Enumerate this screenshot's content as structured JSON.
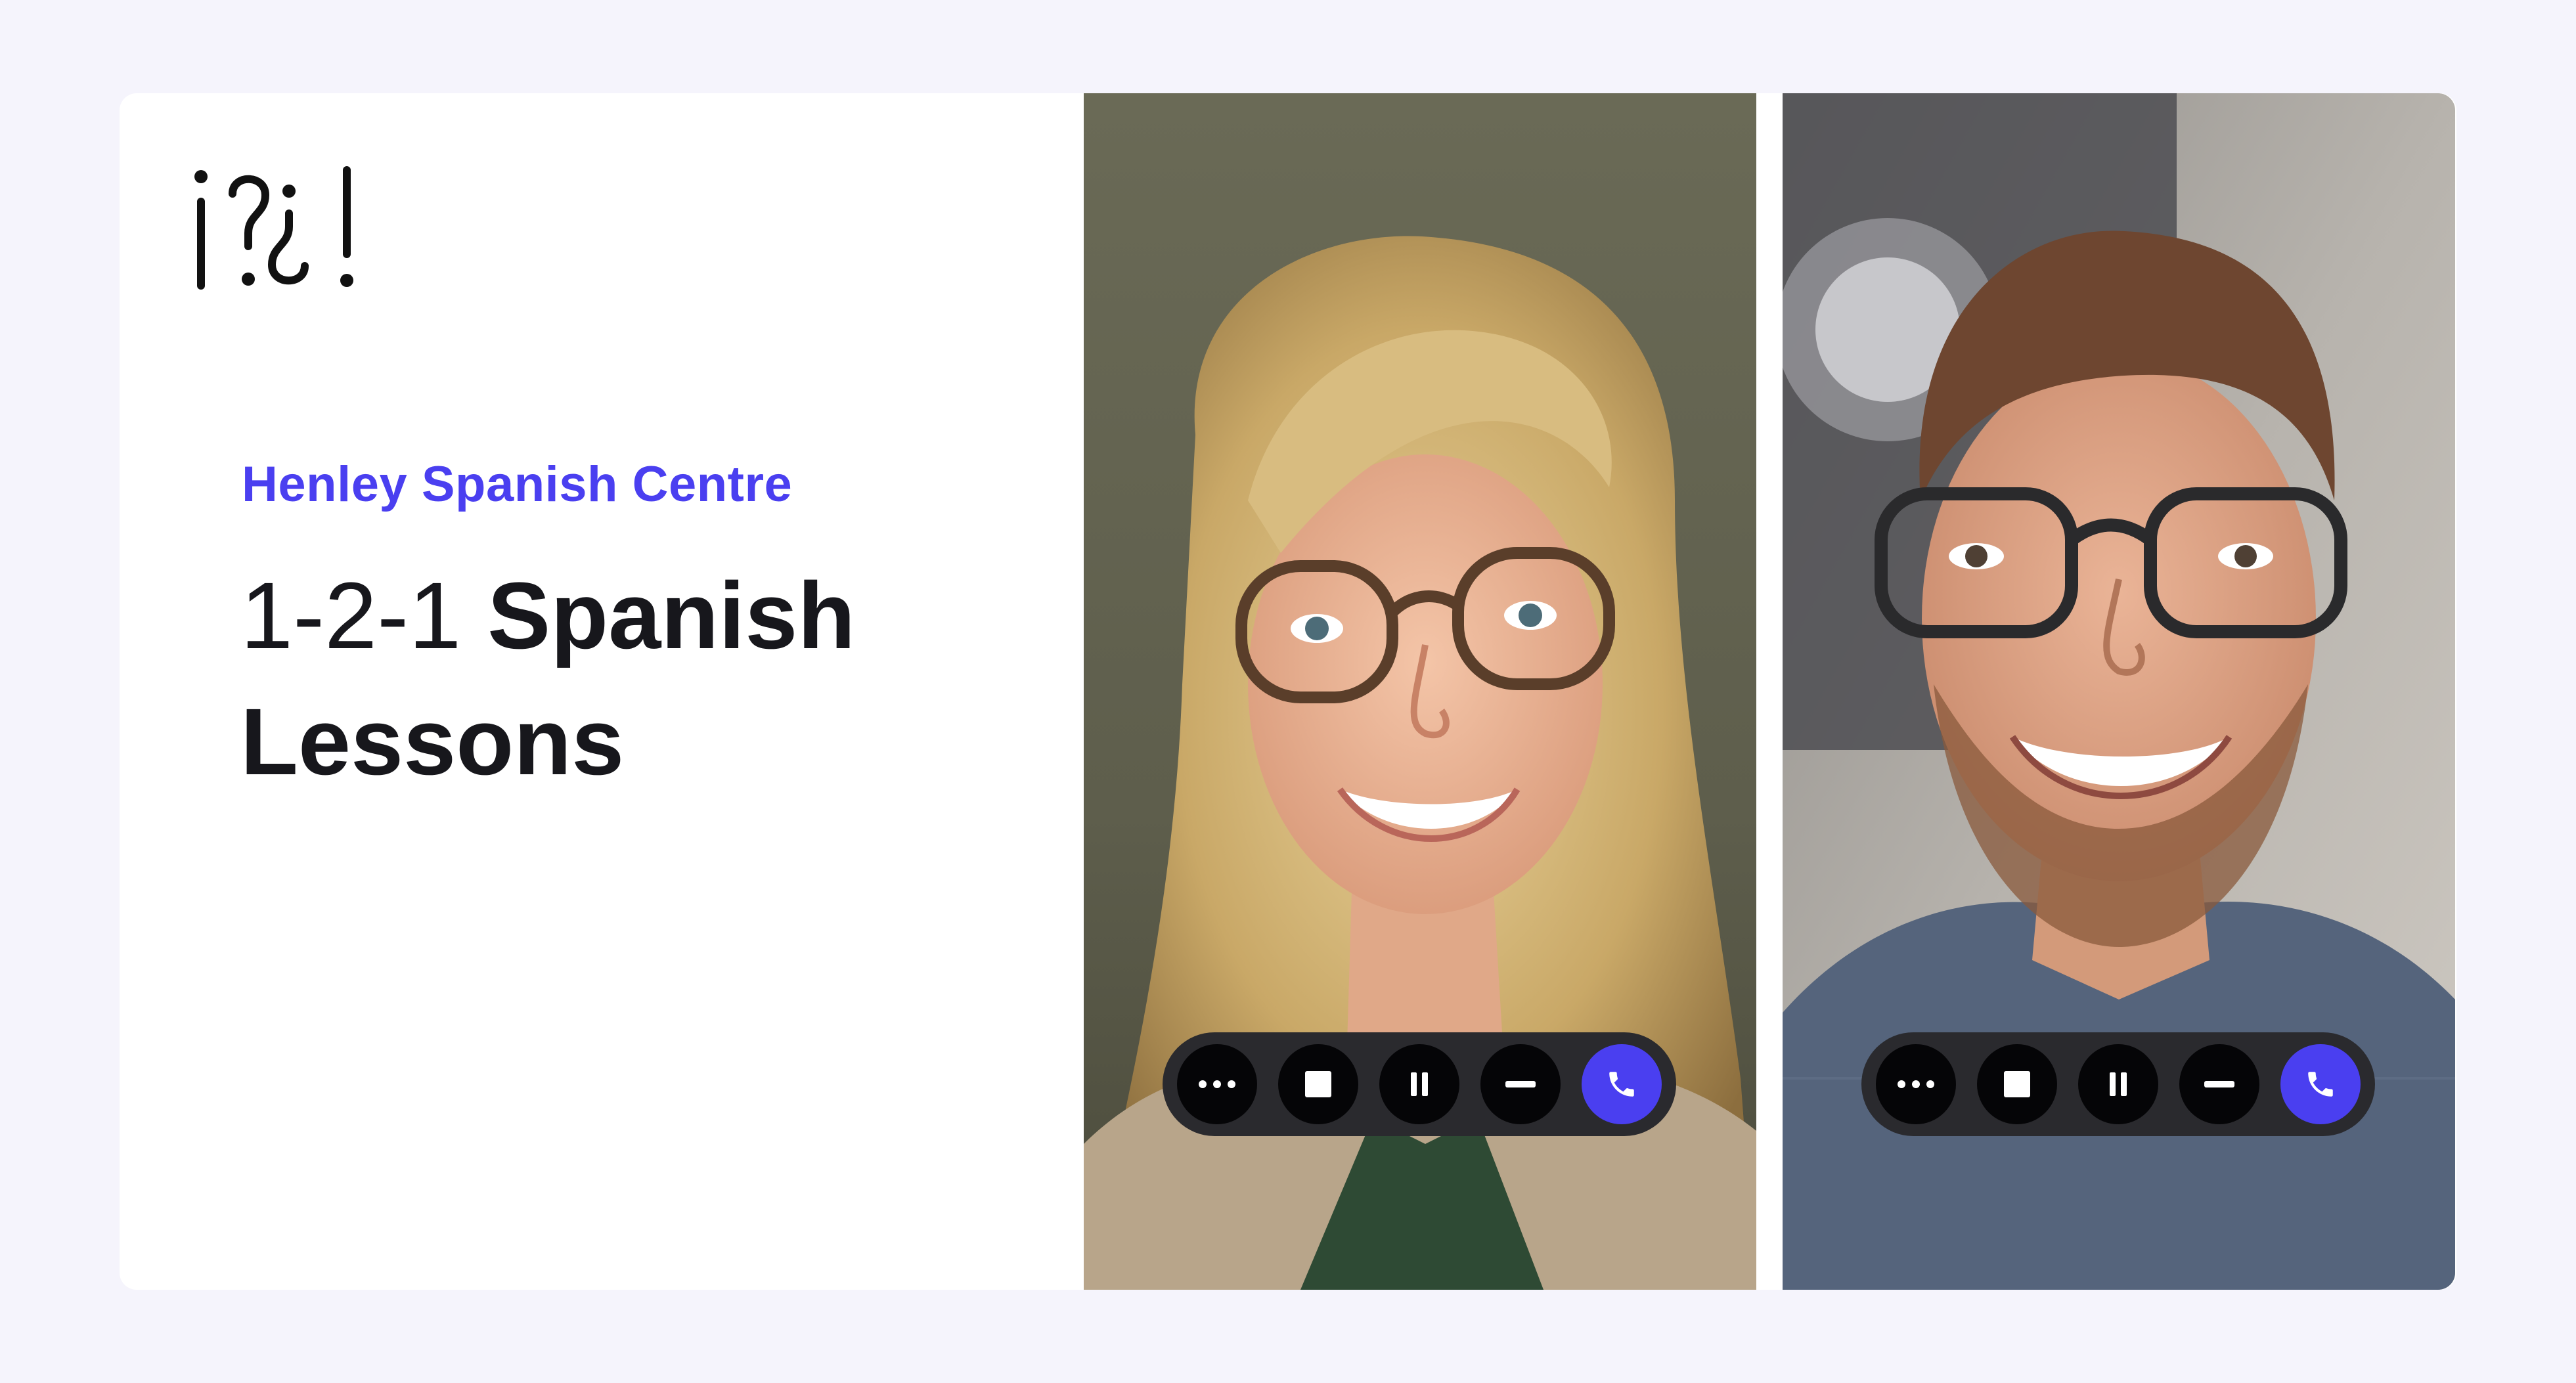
{
  "brand": {
    "logo_icon": "inverted-punctuation-logo",
    "name": "Henley Spanish Centre",
    "accent_color": "#4a3ff0"
  },
  "headline": {
    "part_light": "1-2-1",
    "part_bold_1": "Spanish",
    "part_bold_2": "Lessons"
  },
  "video_tiles": [
    {
      "participant": "woman-with-glasses",
      "controls": [
        "more-icon",
        "stop-icon",
        "pause-icon",
        "minimize-icon",
        "phone-icon"
      ]
    },
    {
      "participant": "man-with-glasses",
      "controls": [
        "more-icon",
        "stop-icon",
        "pause-icon",
        "minimize-icon",
        "phone-icon"
      ]
    }
  ],
  "colors": {
    "page_background": "#f5f4fc",
    "card_background": "#ffffff",
    "control_bar": "#2a2a2e",
    "control_button": "#050507",
    "call_button": "#4a3ff0"
  }
}
